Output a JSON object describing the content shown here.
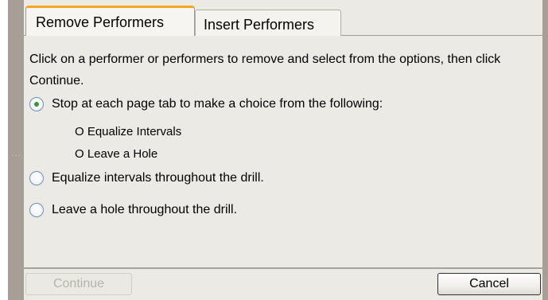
{
  "tabs": [
    {
      "label": "Remove Performers",
      "active": true
    },
    {
      "label": "Insert Performers",
      "active": false
    }
  ],
  "instructions": "Click on a performer or performers to remove and select from the options, then click Continue.",
  "options": {
    "stop_at_each_page": {
      "label": "Stop at each page tab to make a choice from the following:",
      "checked": true,
      "sub_options": [
        "O Equalize Intervals",
        "O Leave a Hole"
      ]
    },
    "equalize": {
      "label": "Equalize intervals throughout the drill.",
      "checked": false
    },
    "leave_hole": {
      "label": "Leave a hole throughout the drill.",
      "checked": false
    }
  },
  "buttons": {
    "continue": {
      "label": "Continue",
      "enabled": false
    },
    "cancel": {
      "label": "Cancel",
      "enabled": true
    }
  },
  "colors": {
    "tab_accent": "#f5a623",
    "radio_selected": "#2f9a3a",
    "frame": "#a79e97",
    "panel_bg": "#eceae5"
  }
}
